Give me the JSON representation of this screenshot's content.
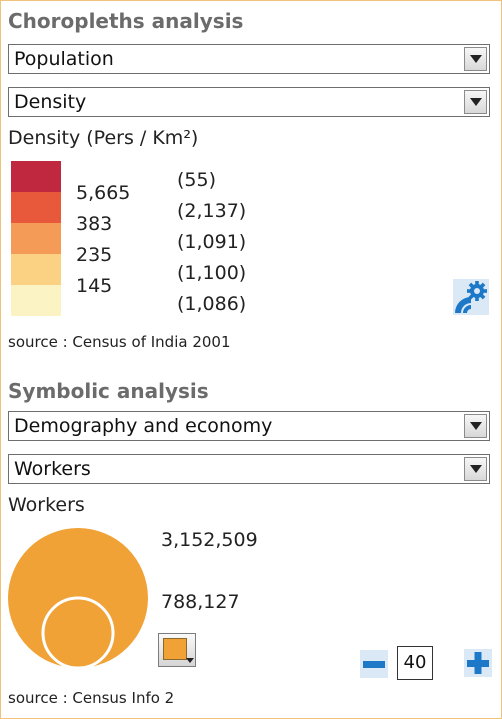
{
  "choropleth": {
    "title": "Choropleths analysis",
    "theme_select": "Population",
    "variable_select": "Density",
    "legend_title": "Density (Pers / Km²)",
    "classes": [
      {
        "color": "#c0283f",
        "count": "(55)"
      },
      {
        "color": "#e8593b",
        "count": "(2,137)"
      },
      {
        "color": "#f59b58",
        "count": "(1,091)"
      },
      {
        "color": "#fbd283",
        "count": "(1,100)"
      },
      {
        "color": "#fbf3c4",
        "count": "(1,086)"
      }
    ],
    "breaks": [
      "5,665",
      "383",
      "235",
      "145"
    ],
    "settings_icon": "gear-settings-icon",
    "source": "source : Census of India 2001"
  },
  "symbolic": {
    "title": "Symbolic analysis",
    "theme_select": "Demography and economy",
    "variable_select": "Workers",
    "legend_title": "Workers",
    "max_value": "3,152,509",
    "min_value": "788,127",
    "symbol_color": "#f0a236",
    "size_value": "40",
    "minus_icon": "minus-icon",
    "plus_icon": "plus-icon",
    "source": "source : Census Info 2"
  },
  "colors": {
    "heading": "#6b6b6b",
    "border": "#f0c27a",
    "button_blue": "#1d78c8"
  }
}
